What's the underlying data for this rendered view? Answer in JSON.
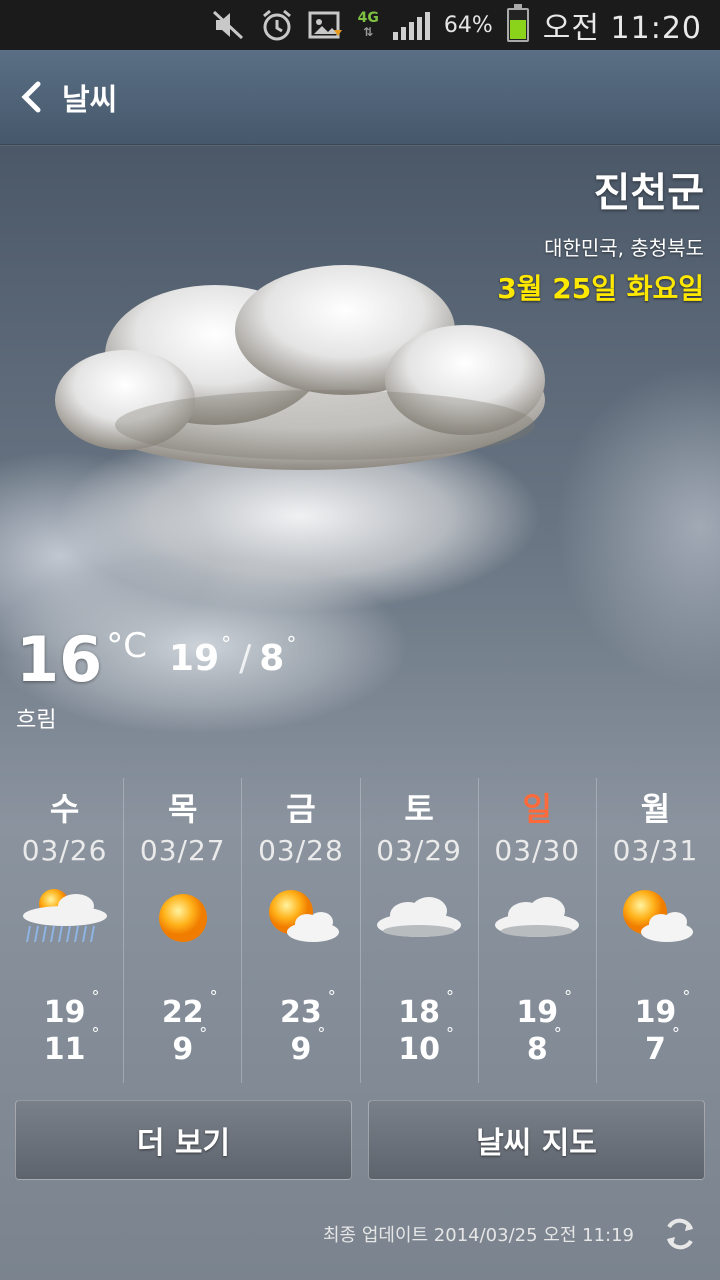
{
  "status_bar": {
    "network": "4G",
    "battery_percent": "64%",
    "battery_level": 0.64,
    "time": "오전 11:20",
    "icons": [
      "mute-icon",
      "alarm-icon",
      "notification-icon",
      "network-4g-icon",
      "signal-icon",
      "battery-icon"
    ]
  },
  "header": {
    "title": "날씨",
    "back_icon": "chevron-left-icon"
  },
  "location": {
    "city": "진천군",
    "region": "대한민국, 충청북도",
    "date": "3월 25일 화요일"
  },
  "current": {
    "temp": "16",
    "unit": "°C",
    "high": "19",
    "low": "8",
    "condition": "흐림"
  },
  "forecast": [
    {
      "day": "수",
      "date": "03/26",
      "icon": "rain-sun-cloud-icon",
      "high": "19",
      "low": "11"
    },
    {
      "day": "목",
      "date": "03/27",
      "icon": "sun-icon",
      "high": "22",
      "low": "9"
    },
    {
      "day": "금",
      "date": "03/28",
      "icon": "partly-cloudy-icon",
      "high": "23",
      "low": "9"
    },
    {
      "day": "토",
      "date": "03/29",
      "icon": "cloud-icon",
      "high": "18",
      "low": "10"
    },
    {
      "day": "일",
      "date": "03/30",
      "icon": "cloud-icon",
      "high": "19",
      "low": "8"
    },
    {
      "day": "월",
      "date": "03/31",
      "icon": "partly-cloudy-icon",
      "high": "19",
      "low": "7"
    }
  ],
  "buttons": {
    "more": "더 보기",
    "map": "날씨 지도"
  },
  "footer": {
    "updated": "최종 업데이트 2014/03/25 오전 11:19"
  },
  "colors": {
    "date_accent": "#ffe800",
    "sunday": "#ff6a3a",
    "header_bg": "#516579"
  }
}
